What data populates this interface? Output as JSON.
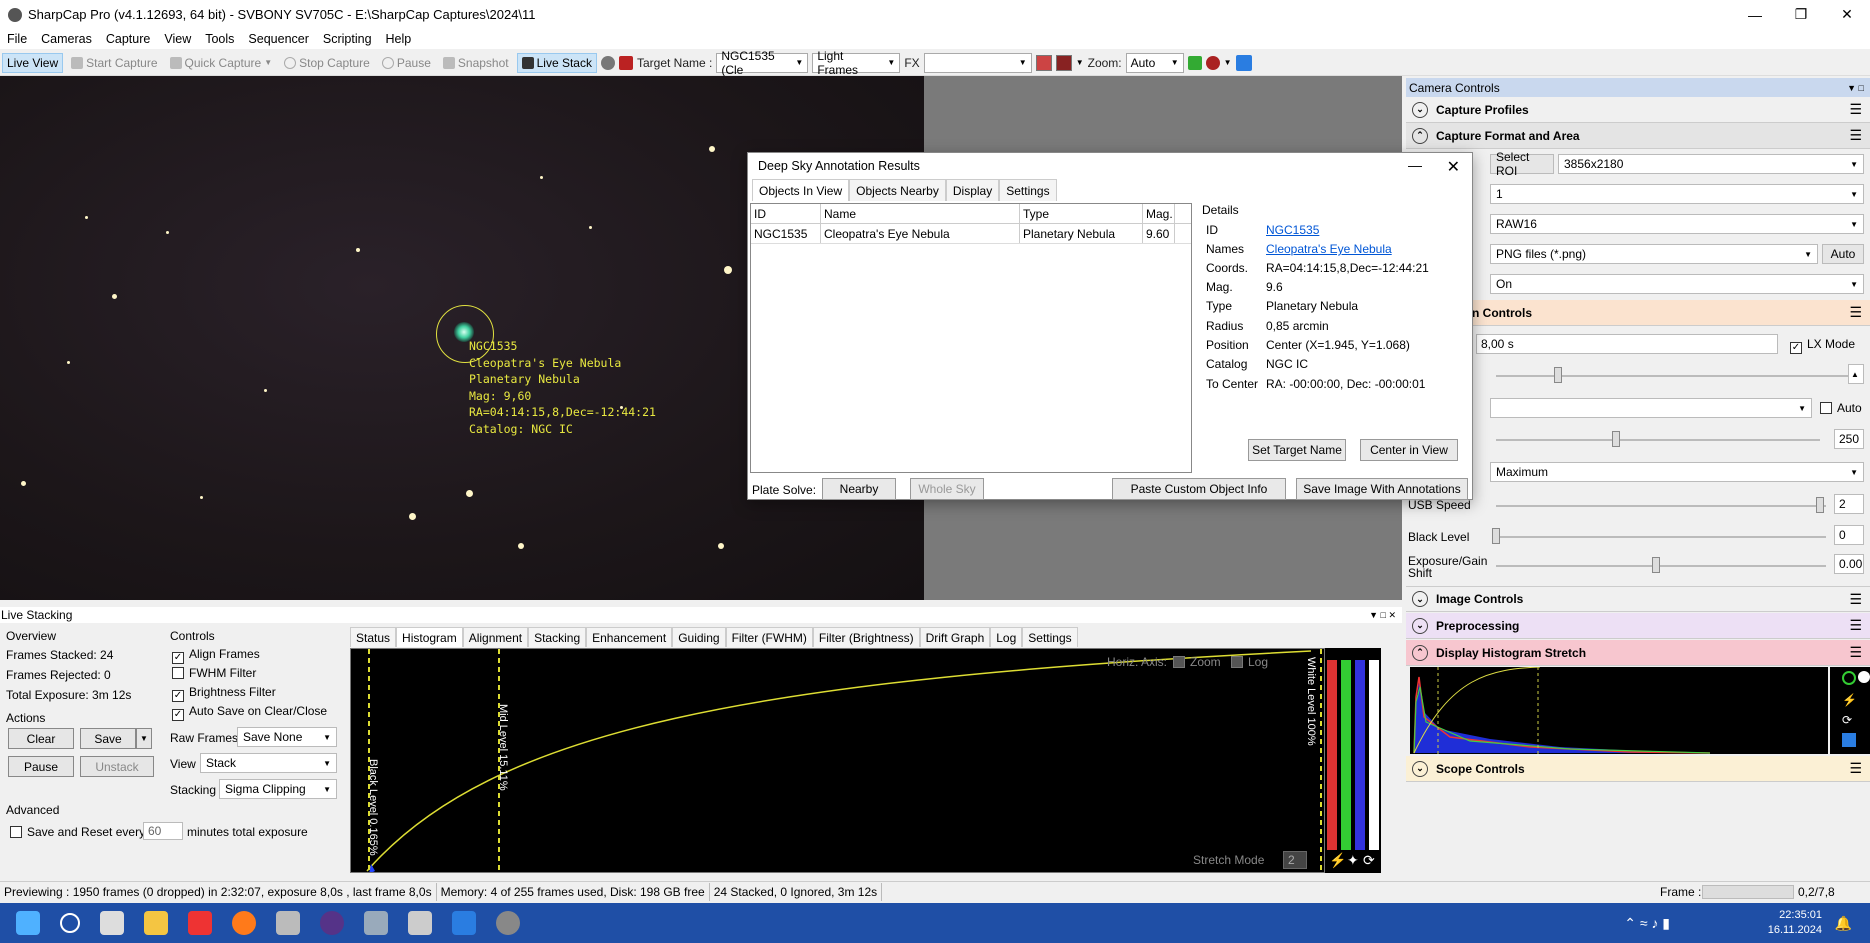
{
  "window": {
    "title": "SharpCap Pro (v4.1.12693, 64 bit) - SVBONY SV705C - E:\\SharpCap Captures\\2024\\11"
  },
  "menu": [
    "File",
    "Cameras",
    "Capture",
    "View",
    "Tools",
    "Sequencer",
    "Scripting",
    "Help"
  ],
  "toolbar": {
    "live_view": "Live View",
    "start_capture": "Start Capture",
    "quick_capture": "Quick Capture",
    "stop_capture": "Stop Capture",
    "pause": "Pause",
    "snapshot": "Snapshot",
    "live_stack": "Live Stack",
    "target_name_label": "Target Name :",
    "target_name_value": "NGC1535 (Cle",
    "frame_type": "Light Frames",
    "fx_label": "FX",
    "zoom_label": "Zoom:",
    "zoom_value": "Auto"
  },
  "image": {
    "annotation_lines": "NGC1535\nCleopatra's Eye Nebula\nPlanetary Nebula\nMag: 9,60\nRA=04:14:15,8,Dec=-12:44:21\nCatalog: NGC IC"
  },
  "dialog": {
    "title": "Deep Sky Annotation Results",
    "tabs": [
      "Objects In View",
      "Objects Nearby",
      "Display",
      "Settings"
    ],
    "columns": [
      "ID",
      "Name",
      "Type",
      "Mag."
    ],
    "rows": [
      {
        "id": "NGC1535",
        "name": "Cleopatra's Eye Nebula",
        "type": "Planetary Nebula",
        "mag": "9.60"
      }
    ],
    "details_title": "Details",
    "details": {
      "id_label": "ID",
      "id": "NGC1535",
      "names_label": "Names",
      "names": "Cleopatra's Eye Nebula",
      "coords_label": "Coords.",
      "coords": "RA=04:14:15,8,Dec=-12:44:21",
      "mag_label": "Mag.",
      "mag": "9.6",
      "type_label": "Type",
      "type": "Planetary Nebula",
      "radius_label": "Radius",
      "radius": "0,85 arcmin",
      "position_label": "Position",
      "position": "Center (X=1.945, Y=1.068)",
      "catalog_label": "Catalog",
      "catalog": "NGC IC",
      "tocenter_label": "To Center",
      "tocenter": "RA: -00:00:00, Dec: -00:00:01"
    },
    "set_target": "Set Target Name",
    "center_in_view": "Center in View",
    "plate_solve_label": "Plate Solve:",
    "nearby": "Nearby",
    "whole_sky": "Whole Sky",
    "paste_custom": "Paste Custom Object Info",
    "save_image": "Save Image With Annotations"
  },
  "camera_controls": {
    "header": "Camera Controls",
    "capture_profiles": "Capture Profiles",
    "capture_format": "Capture Format and Area",
    "select_roi": "Select ROI",
    "resolution": "3856x2180",
    "binning": "1",
    "colour_space": "RAW16",
    "output_format": "PNG files (*.png)",
    "auto": "Auto",
    "debayer": "On",
    "camera_controls_section": "n Controls",
    "exposure": "8,00 s",
    "lx_mode": "LX Mode",
    "auto2": "Auto",
    "gain": "250",
    "mode": "Maximum",
    "usb_speed_label": "USB Speed",
    "usb_speed": "2",
    "black_level_label": "Black Level",
    "black_level": "0",
    "exposure_gain_shift_label": "Exposure/Gain Shift",
    "exposure_gain_shift": "0.00",
    "image_controls": "Image Controls",
    "preprocessing": "Preprocessing",
    "display_histogram": "Display Histogram Stretch",
    "scope_controls": "Scope Controls"
  },
  "live_stacking": {
    "header": "Live Stacking",
    "overview": "Overview",
    "frames_stacked": "Frames Stacked:  24",
    "frames_rejected": "Frames Rejected: 0",
    "total_exposure": "Total Exposure:   3m 12s",
    "actions": "Actions",
    "clear": "Clear",
    "save": "Save",
    "pause": "Pause",
    "unstack": "Unstack",
    "advanced": "Advanced",
    "save_reset_a": "Save and Reset every",
    "save_reset_value": "60",
    "save_reset_b": "minutes total exposure",
    "controls": "Controls",
    "align_frames": "Align Frames",
    "fwhm_filter": "FWHM Filter",
    "brightness_filter": "Brightness Filter",
    "auto_save": "Auto Save on Clear/Close",
    "raw_frames_label": "Raw Frames",
    "raw_frames": "Save None",
    "view_label": "View",
    "view": "Stack",
    "stacking_label": "Stacking",
    "stacking": "Sigma Clipping",
    "tabs": [
      "Status",
      "Histogram",
      "Alignment",
      "Stacking",
      "Enhancement",
      "Guiding",
      "Filter (FWHM)",
      "Filter (Brightness)",
      "Drift Graph",
      "Log",
      "Settings"
    ],
    "horiz_axis": "Horiz. Axis:",
    "zoom": "Zoom",
    "log": "Log",
    "black_level": "Black Level 0.165%",
    "mid_level": "Mid Level 15.11%",
    "white_level": "White Level 100%",
    "stretch_mode": "Stretch Mode",
    "stretch_value": "2"
  },
  "status": {
    "previewing": "Previewing : 1950 frames (0 dropped) in 2:32:07, exposure 8,0s , last frame 8,0s",
    "memory": "Memory: 4 of 255 frames used, Disk: 198 GB free",
    "stacked": "24 Stacked, 0 Ignored, 3m 12s",
    "frame_label": "Frame :",
    "frame_value": "0,2/7,8"
  },
  "clock": {
    "time": "22:35:01",
    "date": "16.11.2024"
  }
}
